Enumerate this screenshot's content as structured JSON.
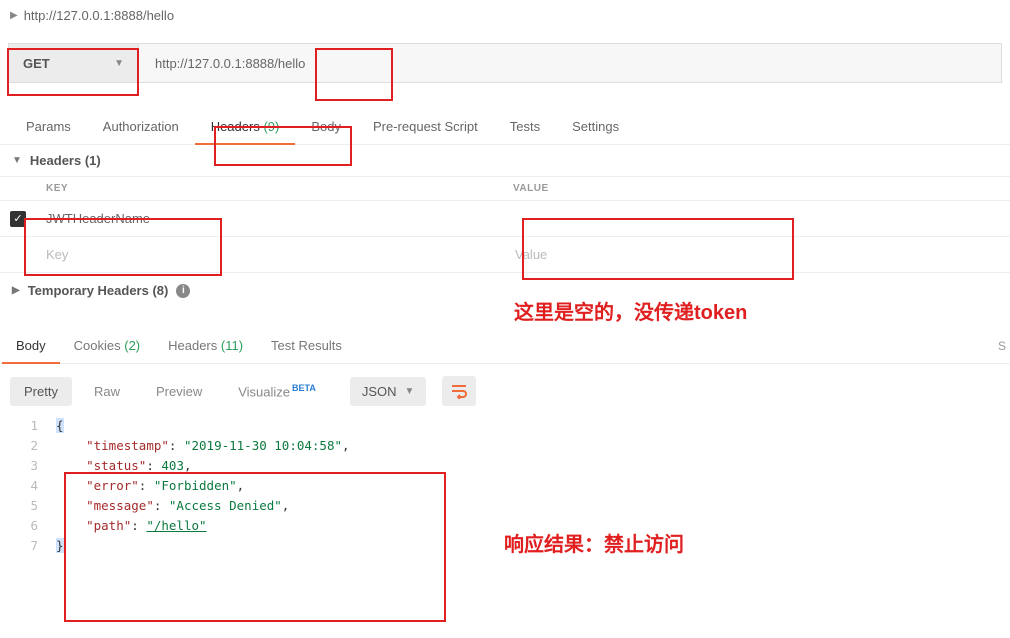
{
  "top": {
    "url_summary": "http://127.0.0.1:8888/hello"
  },
  "request": {
    "method": "GET",
    "url": "http://127.0.0.1:8888/hello",
    "tabs": {
      "params": "Params",
      "authorization": "Authorization",
      "headers_label": "Headers",
      "headers_count": "(9)",
      "body": "Body",
      "prerequest": "Pre-request Script",
      "tests": "Tests",
      "settings": "Settings"
    }
  },
  "headers": {
    "section_label": "Headers  (1)",
    "col_key": "KEY",
    "col_value": "VALUE",
    "row1_key": "JWTHeaderName",
    "row1_value": "",
    "placeholder_key": "Key",
    "placeholder_value": "Value",
    "temp_label": "Temporary Headers  (8)"
  },
  "response": {
    "tabs": {
      "body": "Body",
      "cookies_label": "Cookies",
      "cookies_count": "(2)",
      "headers_label": "Headers",
      "headers_count": "(11)",
      "test_results": "Test Results"
    },
    "right_s": "S",
    "views": {
      "pretty": "Pretty",
      "raw": "Raw",
      "preview": "Preview",
      "visualize": "Visualize",
      "beta": "BETA"
    },
    "format": "JSON",
    "json_lines": {
      "n1": "1",
      "n2": "2",
      "n3": "3",
      "n4": "4",
      "n5": "5",
      "n6": "6",
      "n7": "7",
      "l1_open": "{",
      "k_timestamp": "\"timestamp\"",
      "v_timestamp": "\"2019-11-30 10:04:58\"",
      "k_status": "\"status\"",
      "v_status": "403",
      "k_error": "\"error\"",
      "v_error": "\"Forbidden\"",
      "k_message": "\"message\"",
      "v_message": "\"Access Denied\"",
      "k_path": "\"path\"",
      "v_path": "\"/hello\"",
      "l7_close": "}",
      "colon": ": ",
      "comma": ","
    }
  },
  "annotations": {
    "empty_token": "这里是空的，没传递token",
    "resp_result": "响应结果：禁止访问"
  }
}
